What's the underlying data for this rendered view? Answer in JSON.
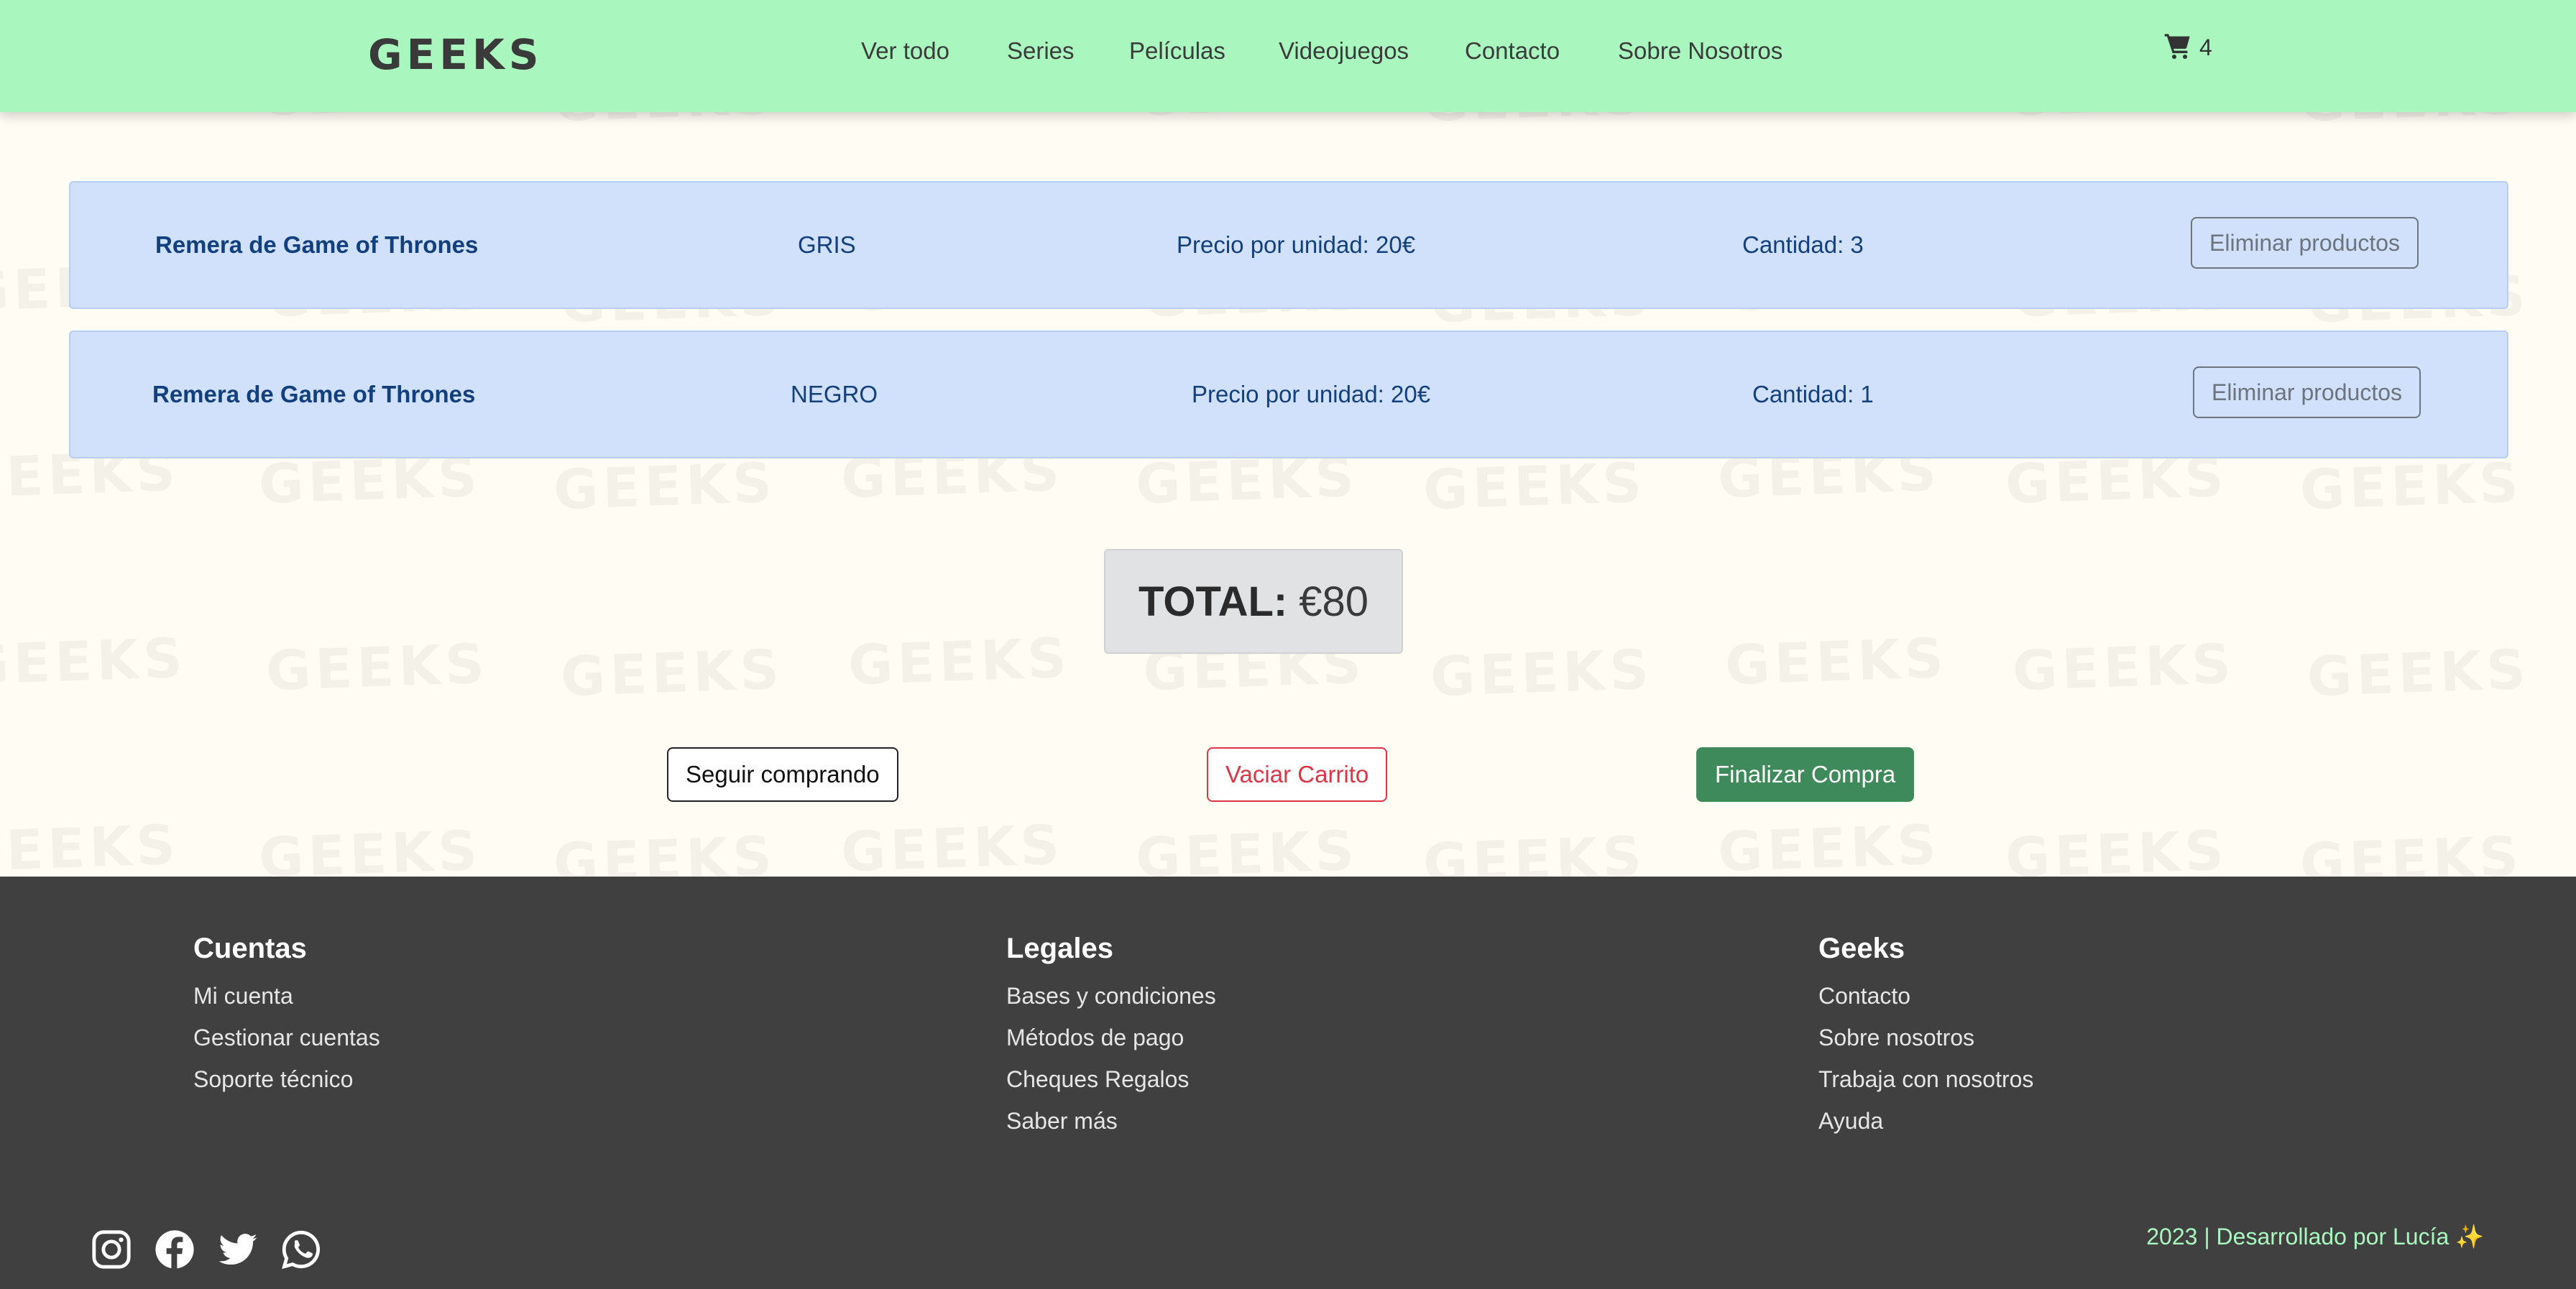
{
  "header": {
    "logo": "GEEKS",
    "nav": [
      "Ver todo",
      "Series",
      "Películas",
      "Videojuegos",
      "Contacto",
      "Sobre Nosotros"
    ],
    "cart_count": "4"
  },
  "watermark_text": "GEEKS",
  "cart_items": [
    {
      "name": "Remera de Game of Thrones",
      "color": "GRIS",
      "unit_price": "Precio por unidad: 20€",
      "quantity": "Cantidad: 3",
      "remove_label": "Eliminar productos"
    },
    {
      "name": "Remera de Game of Thrones",
      "color": "NEGRO",
      "unit_price": "Precio por unidad: 20€",
      "quantity": "Cantidad: 1",
      "remove_label": "Eliminar productos"
    }
  ],
  "total": {
    "label": "TOTAL:",
    "amount": "€80"
  },
  "actions": {
    "continue": "Seguir comprando",
    "empty": "Vaciar Carrito",
    "checkout": "Finalizar Compra"
  },
  "footer": {
    "columns": [
      {
        "title": "Cuentas",
        "links": [
          "Mi cuenta",
          "Gestionar cuentas",
          "Soporte técnico"
        ]
      },
      {
        "title": "Legales",
        "links": [
          "Bases y condiciones",
          "Métodos de pago",
          "Cheques Regalos",
          "Saber más"
        ]
      },
      {
        "title": "Geeks",
        "links": [
          "Contacto",
          "Sobre nosotros",
          "Trabaja con nosotros",
          "Ayuda"
        ]
      }
    ],
    "social_icons": [
      "instagram-icon",
      "facebook-icon",
      "twitter-icon",
      "whatsapp-icon"
    ],
    "credit": "2023 | Desarrollado por Lucía ✨"
  },
  "colors": {
    "header_bg": "#a9f7be",
    "row_bg": "#d1e0fb",
    "footer_bg": "#404040",
    "checkout": "#3f8a5a",
    "danger": "#dc3545"
  }
}
